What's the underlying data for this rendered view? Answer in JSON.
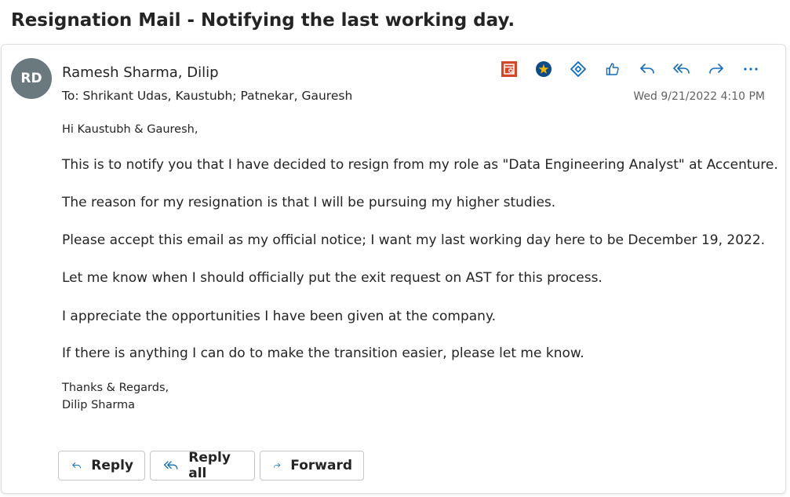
{
  "subject": "Resignation Mail - Notifying the last working day.",
  "header": {
    "avatar_initials": "RD",
    "avatar_color": "#69797e",
    "from": "Ramesh Sharma, Dilip",
    "to": "To:  Shrikant Udas, Kaustubh;  Patnekar, Gauresh",
    "datetime": "Wed 9/21/2022 4:10 PM"
  },
  "toolbar": {
    "icons": [
      "calendar-addin-icon",
      "star-addin-icon",
      "loop-addin-icon",
      "like-icon",
      "reply-icon",
      "reply-all-icon",
      "forward-icon",
      "more-icon"
    ],
    "accent_orange": "#d24726",
    "accent_blue": "#0f6cbd",
    "star_bg": "#0b4a8b",
    "star_color": "#f2b600"
  },
  "body": {
    "greeting": "Hi Kaustubh & Gauresh,",
    "paragraphs": [
      "This is to notify you that I have decided to resign from my role as \"Data Engineering Analyst\" at Accenture.",
      "The reason for my resignation is that I will be pursuing my higher studies.",
      "Please accept this email as my official notice; I want my last working day here to be December 19, 2022.",
      "Let me know when I should officially put the exit request on AST for this process.",
      "I appreciate the opportunities I have been given at the company.",
      "If there is anything I can do to make the transition easier, please let me know."
    ],
    "closing": "Thanks & Regards,",
    "signature": "Dilip Sharma"
  },
  "actions": {
    "reply": "Reply",
    "reply_all": "Reply all",
    "forward": "Forward"
  }
}
